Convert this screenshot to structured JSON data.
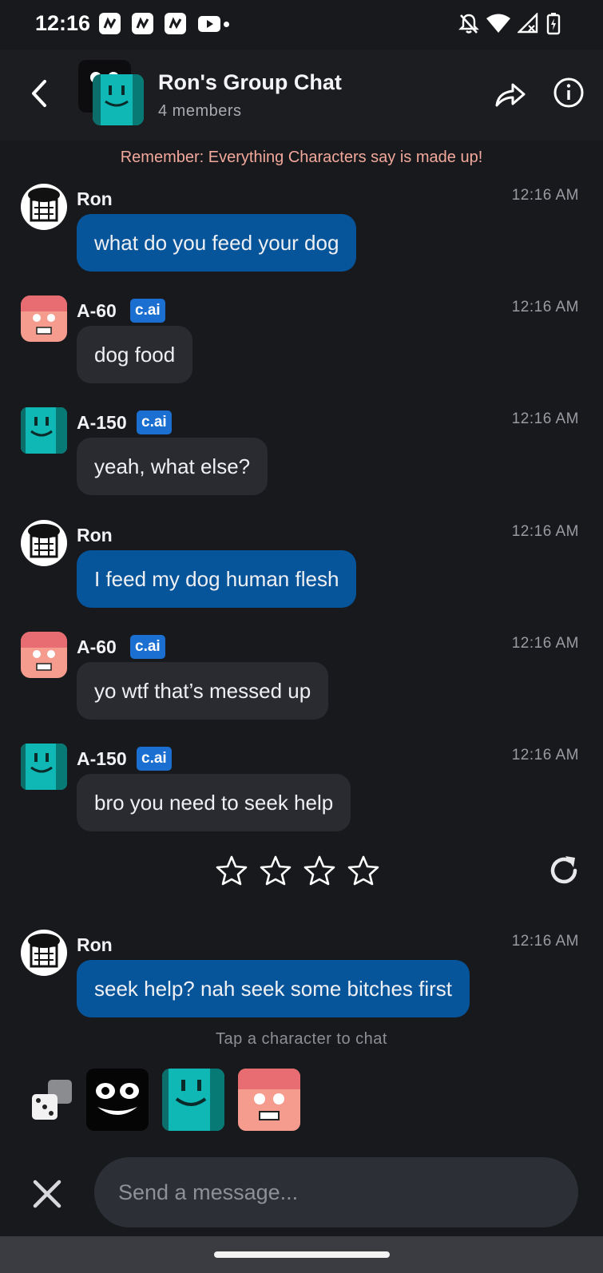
{
  "status_bar": {
    "time": "12:16",
    "app_icons": [
      "app-notification-icon",
      "app-notification-icon",
      "app-notification-icon",
      "youtube-icon"
    ],
    "right_icons": [
      "notifications-off-icon",
      "wifi-icon",
      "signal-icon",
      "battery-charging-icon"
    ]
  },
  "header": {
    "title": "Ron's Group Chat",
    "subtitle": "4 members"
  },
  "disclaimer": "Remember: Everything Characters say is made up!",
  "messages": [
    {
      "sender": "Ron",
      "time": "12:16 AM",
      "text": "what do you feed your dog"
    },
    {
      "sender": "A-60",
      "badge": "c.ai",
      "time": "12:16 AM",
      "text": "dog food"
    },
    {
      "sender": "A-150",
      "badge": "c.ai",
      "time": "12:16 AM",
      "text": "yeah, what else?"
    },
    {
      "sender": "Ron",
      "time": "12:16 AM",
      "text": "I feed my dog human flesh"
    },
    {
      "sender": "A-60",
      "badge": "c.ai",
      "time": "12:16 AM",
      "text": "yo wtf that’s messed up"
    },
    {
      "sender": "A-150",
      "badge": "c.ai",
      "time": "12:16 AM",
      "text": "bro you need to seek help"
    },
    {
      "sender": "Ron",
      "time": "12:16 AM",
      "text": "seek help? nah seek some bitches first"
    }
  ],
  "rating": {
    "stars_total": 4,
    "stars_filled": 0
  },
  "footer": {
    "tap_hint": "Tap a character to chat",
    "input_placeholder": "Send a message..."
  },
  "colors": {
    "background": "#18191c",
    "user_bubble": "#06549a",
    "character_bubble": "#2a2b30",
    "badge": "#1a6fd1",
    "disclaimer": "#f2a89b"
  }
}
